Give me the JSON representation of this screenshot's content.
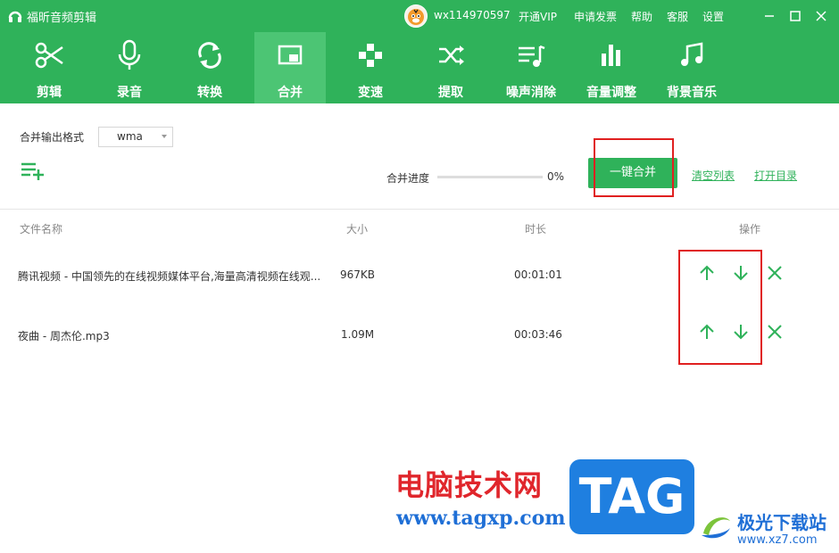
{
  "app": {
    "title": "福昕音频剪辑",
    "username": "wx114970597",
    "links": {
      "vip": "开通VIP",
      "invoice": "申请发票",
      "help": "帮助",
      "service": "客服",
      "settings": "设置"
    },
    "accent": "#2fb25a"
  },
  "toolbar": {
    "active": "合并",
    "items": [
      {
        "label": "剪辑",
        "icon": "scissors-icon"
      },
      {
        "label": "录音",
        "icon": "microphone-icon"
      },
      {
        "label": "转换",
        "icon": "convert-icon"
      },
      {
        "label": "合并",
        "icon": "merge-icon"
      },
      {
        "label": "变速",
        "icon": "speed-icon"
      },
      {
        "label": "提取",
        "icon": "extract-icon"
      },
      {
        "label": "噪声消除",
        "icon": "noise-removal-icon"
      },
      {
        "label": "音量调整",
        "icon": "volume-bars-icon"
      },
      {
        "label": "背景音乐",
        "icon": "music-note-icon"
      }
    ]
  },
  "merge": {
    "format_label": "合并输出格式",
    "format_value": "wma",
    "progress_label": "合并进度",
    "progress_value": "0%",
    "progress_fraction": 0,
    "merge_button": "一键合并",
    "clear_list": "清空列表",
    "open_dir": "打开目录"
  },
  "table": {
    "headers": {
      "name": "文件名称",
      "size": "大小",
      "duration": "时长",
      "actions": "操作"
    },
    "rows": [
      {
        "name": "腾讯视频 - 中国领先的在线视频媒体平台,海量高清视频在线观...",
        "size": "967KB",
        "duration": "00:01:01"
      },
      {
        "name": "夜曲 - 周杰伦.mp3",
        "size": "1.09M",
        "duration": "00:03:46"
      }
    ]
  },
  "watermark": {
    "site_cn": "电脑技术网",
    "site_url": "www.tagxp.com",
    "tag": "TAG",
    "jg_name": "极光下载站",
    "jg_url": "www.xz7.com"
  }
}
